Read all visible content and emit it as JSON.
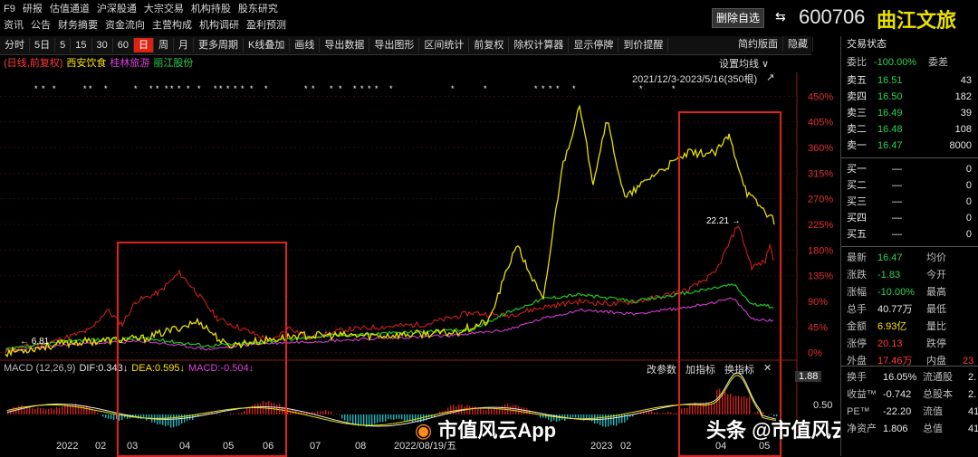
{
  "menu_row1": [
    "F9",
    "研报",
    "估值通道",
    "沪深股通",
    "大宗交易",
    "机构持股",
    "股东研究"
  ],
  "menu_row2": [
    "资讯",
    "公告",
    "财务摘要",
    "资金流向",
    "主营构成",
    "机构调研",
    "盈利预测"
  ],
  "header": {
    "remove_watch": "删除自选",
    "code": "600706",
    "name": "曲江文旅"
  },
  "toolbar": [
    "分时",
    "5日",
    "5",
    "15",
    "30",
    "60",
    "日",
    "周",
    "月",
    "更多周期",
    "K线叠加",
    "画线",
    "导出数据",
    "导出图形",
    "区间统计",
    "前复权",
    "除权计算器",
    "显示停牌",
    "到价提醒"
  ],
  "toolbar_active": "日",
  "toolbar_right": [
    "简约版面",
    "隐藏"
  ],
  "legend": {
    "prefix": "(日线,前复权)",
    "s1": "西安饮食",
    "s2": "桂林旅游",
    "s3": "丽江股份"
  },
  "chart_controls": {
    "set_ma": "设置均线",
    "range": "2021/12/3-2023/5/16(350根)"
  },
  "y_axis_ticks": [
    "450%",
    "405%",
    "360%",
    "315%",
    "270%",
    "225%",
    "180%",
    "135%",
    "90%",
    "45%",
    "0%"
  ],
  "x_axis_ticks": [
    "2022",
    "02",
    "03",
    "04",
    "05",
    "06",
    "07",
    "08",
    "2022/08/19/五",
    "2023",
    "02",
    "04",
    "05"
  ],
  "price_label_start": "6.81",
  "peak_label": "22.21",
  "macd": {
    "title": "MACD (12,26,9)",
    "dif": "DIF:0.343↓",
    "dea": "DEA:0.595↓",
    "macd": "MACD:-0.504↓",
    "btn_params": "改参数",
    "btn_add": "加指标",
    "btn_swap": "换指标",
    "close": "✕",
    "scale_top": "1.88",
    "scale_mid": "0.50"
  },
  "watermark": {
    "weibo": "市值风云App",
    "toutiao_prefix": "头条",
    "toutiao": "@市值风云客户端"
  },
  "right": {
    "title_state": "交易状态",
    "weibi_label": "委比",
    "weibi": "-100.00%",
    "weicha_label": "委差",
    "sells": [
      {
        "label": "卖五",
        "price": "16.51",
        "vol": "43"
      },
      {
        "label": "卖四",
        "price": "16.50",
        "vol": "182"
      },
      {
        "label": "卖三",
        "price": "16.49",
        "vol": "39"
      },
      {
        "label": "卖二",
        "price": "16.48",
        "vol": "108"
      },
      {
        "label": "卖一",
        "price": "16.47",
        "vol": "8000"
      }
    ],
    "buys": [
      {
        "label": "买一",
        "price": "—",
        "vol": "0"
      },
      {
        "label": "买二",
        "price": "—",
        "vol": "0"
      },
      {
        "label": "买三",
        "price": "—",
        "vol": "0"
      },
      {
        "label": "买四",
        "price": "—",
        "vol": "0"
      },
      {
        "label": "买五",
        "price": "—",
        "vol": "0"
      }
    ],
    "quotes": [
      {
        "l1": "最新",
        "v1": "16.47",
        "c1": "green",
        "l2": "均价",
        "v2": ""
      },
      {
        "l1": "涨跌",
        "v1": "-1.83",
        "c1": "green",
        "l2": "今开",
        "v2": ""
      },
      {
        "l1": "涨幅",
        "v1": "-10.00%",
        "c1": "green",
        "l2": "最高",
        "v2": ""
      },
      {
        "l1": "总手",
        "v1": "40.77万",
        "c1": "white",
        "l2": "最低",
        "v2": ""
      },
      {
        "l1": "金额",
        "v1": "6.93亿",
        "c1": "yellow",
        "l2": "量比",
        "v2": ""
      },
      {
        "l1": "涨停",
        "v1": "20.13",
        "c1": "red",
        "l2": "跌停",
        "v2": ""
      },
      {
        "l1": "外盘",
        "v1": "17.46万",
        "c1": "red",
        "l2": "内盘",
        "v2": "23"
      }
    ],
    "fund": [
      {
        "l1": "换手",
        "v1": "16.05%",
        "l2": "流通股",
        "v2": "2."
      },
      {
        "l1": "收益™",
        "v1": "-0.742",
        "l2": "总股本",
        "v2": "2."
      },
      {
        "l1": "PE™",
        "v1": "-22.20",
        "l2": "流值",
        "v2": "41"
      },
      {
        "l1": "净资产",
        "v1": "1.806",
        "l2": "总值",
        "v2": "41"
      }
    ]
  },
  "colors": {
    "xian": "#e8e000",
    "guilin": "#e040e0",
    "lijiang": "#1ec81e",
    "main": "#e02020"
  }
}
